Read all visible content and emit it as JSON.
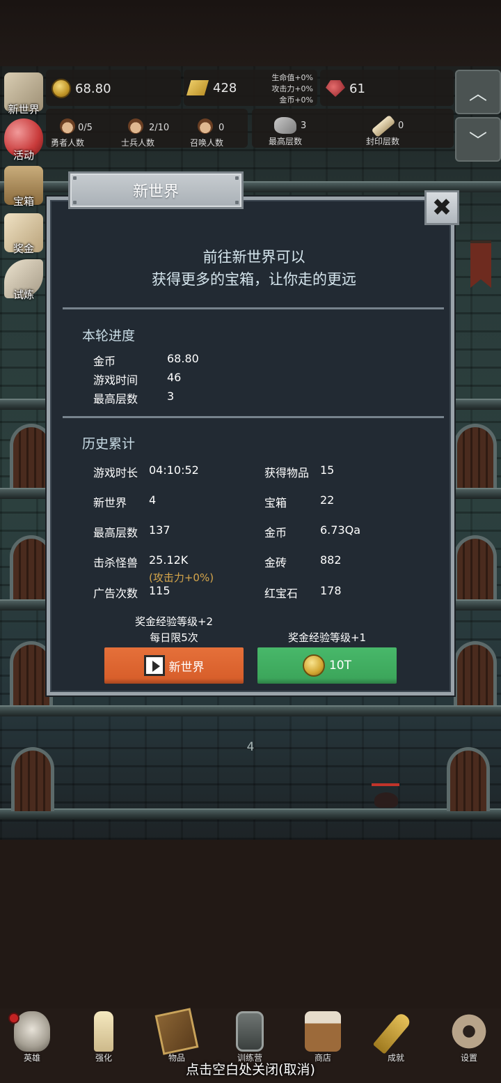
{
  "resources": {
    "coins": "68.80",
    "gold_bars": "428",
    "rubies": "61",
    "bonus_hp": "生命值+0%",
    "bonus_attack": "攻击力+0%",
    "bonus_coins": "金币+0%"
  },
  "stats": {
    "heroes_value": "0/5",
    "heroes_label": "勇者人数",
    "soldiers_value": "2/10",
    "soldiers_label": "士兵人数",
    "summons_value": "0",
    "summons_label": "召唤人数",
    "max_floor_value": "3",
    "max_floor_label": "最高层数",
    "sealed_value": "0",
    "sealed_label": "封印层数"
  },
  "scroll_buttons": {
    "up": "︿",
    "down": "﹀"
  },
  "side_menu": [
    {
      "label": "新世界",
      "icon": "map-icon"
    },
    {
      "label": "活动",
      "icon": "heart-icon"
    },
    {
      "label": "宝箱",
      "icon": "chest-icon"
    },
    {
      "label": "奖金",
      "icon": "envelope-icon"
    },
    {
      "label": "试炼",
      "icon": "feather-icon"
    }
  ],
  "dungeon": {
    "floor_number": "4"
  },
  "modal": {
    "title": "新世界",
    "close": "✖",
    "intro_line1": "前往新世界可以",
    "intro_line2": "获得更多的宝箱，让你走的更远",
    "round_title": "本轮进度",
    "round": [
      {
        "label": "金币",
        "value": "68.80"
      },
      {
        "label": "游戏时间",
        "value": "46"
      },
      {
        "label": "最高层数",
        "value": "3"
      }
    ],
    "history_title": "历史累计",
    "history_left": [
      {
        "label": "游戏时长",
        "value": "04:10:52"
      },
      {
        "label": "新世界",
        "value": "4"
      },
      {
        "label": "最高层数",
        "value": "137"
      },
      {
        "label": "击杀怪兽",
        "value": "25.12K"
      },
      {
        "label": "广告次数",
        "value": "115"
      }
    ],
    "kill_note": "(攻击力+0%)",
    "history_right": [
      {
        "label": "获得物品",
        "value": "15"
      },
      {
        "label": "宝箱",
        "value": "22"
      },
      {
        "label": "金币",
        "value": "6.73Qa"
      },
      {
        "label": "金砖",
        "value": "882"
      },
      {
        "label": "红宝石",
        "value": "178"
      }
    ],
    "left_caption_1": "奖金经验等级+2",
    "left_caption_2": "每日限5次",
    "right_caption": "奖金经验等级+1",
    "video_button": "新世界",
    "coin_button": "10T"
  },
  "bottom_nav": [
    {
      "label": "英雄",
      "icon": "skull-icon"
    },
    {
      "label": "强化",
      "icon": "candle-icon"
    },
    {
      "label": "物品",
      "icon": "book-icon"
    },
    {
      "label": "训练营",
      "icon": "lantern-icon"
    },
    {
      "label": "商店",
      "icon": "mug-icon"
    },
    {
      "label": "成就",
      "icon": "key-icon"
    },
    {
      "label": "设置",
      "icon": "gear-icon"
    }
  ],
  "dismiss_text": "点击空白处关闭(取消)"
}
